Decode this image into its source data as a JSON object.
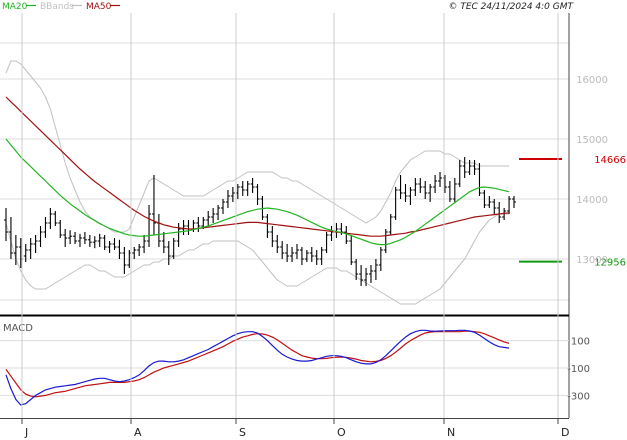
{
  "header": {
    "legend": [
      {
        "label": "MA20",
        "color": "#22b422"
      },
      {
        "label": "BBands",
        "color": "#c0c0c0"
      },
      {
        "label": "MA50",
        "color": "#a01010"
      }
    ],
    "copyright": "© TEC 24/11/2024 4:0 GMT"
  },
  "chart_data": [
    {
      "type": "line",
      "title": "",
      "x_tick_labels": [
        "J",
        "A",
        "S",
        "O",
        "N",
        "D"
      ],
      "y_tick_labels": [
        "13000",
        "14000",
        "15000",
        "16000"
      ],
      "ylim": [
        12100,
        17100
      ],
      "series_colors": {
        "price": "#000000",
        "ma20": "#22b422",
        "ma50": "#a01010",
        "bbands": "#c0c0c0"
      },
      "levels": [
        {
          "label": "14666",
          "value": 14666,
          "color": "#cc0000"
        },
        {
          "label": "12956",
          "value": 12956,
          "color": "#119911"
        }
      ],
      "candles": [
        [
          13650,
          13850,
          13300,
          13450
        ],
        [
          13450,
          13700,
          13000,
          13100
        ],
        [
          13100,
          13400,
          12900,
          13200
        ],
        [
          13200,
          13350,
          12850,
          13000
        ],
        [
          13050,
          13250,
          12950,
          13150
        ],
        [
          13150,
          13350,
          13000,
          13250
        ],
        [
          13250,
          13400,
          13100,
          13300
        ],
        [
          13300,
          13550,
          13200,
          13450
        ],
        [
          13450,
          13700,
          13350,
          13600
        ],
        [
          13600,
          13850,
          13500,
          13750
        ],
        [
          13750,
          13800,
          13550,
          13600
        ],
        [
          13600,
          13650,
          13350,
          13400
        ],
        [
          13400,
          13500,
          13200,
          13350
        ],
        [
          13350,
          13480,
          13250,
          13380
        ],
        [
          13380,
          13450,
          13250,
          13300
        ],
        [
          13300,
          13420,
          13200,
          13350
        ],
        [
          13350,
          13450,
          13250,
          13320
        ],
        [
          13320,
          13400,
          13200,
          13280
        ],
        [
          13280,
          13380,
          13180,
          13300
        ],
        [
          13300,
          13420,
          13200,
          13350
        ],
        [
          13350,
          13400,
          13150,
          13200
        ],
        [
          13200,
          13300,
          13100,
          13250
        ],
        [
          13250,
          13350,
          13150,
          13200
        ],
        [
          13200,
          13320,
          13000,
          13100
        ],
        [
          13100,
          13200,
          12750,
          12900
        ],
        [
          12900,
          13150,
          12850,
          13100
        ],
        [
          13100,
          13200,
          13000,
          13150
        ],
        [
          13150,
          13250,
          13050,
          13200
        ],
        [
          13200,
          13400,
          13100,
          13300
        ],
        [
          13300,
          13900,
          13200,
          13750
        ],
        [
          13750,
          14400,
          13400,
          13600
        ],
        [
          13600,
          13750,
          13200,
          13300
        ],
        [
          13300,
          13450,
          13100,
          13200
        ],
        [
          13200,
          13300,
          12900,
          13050
        ],
        [
          13050,
          13350,
          13000,
          13300
        ],
        [
          13300,
          13600,
          13200,
          13500
        ],
        [
          13500,
          13650,
          13400,
          13550
        ],
        [
          13550,
          13650,
          13400,
          13500
        ],
        [
          13500,
          13650,
          13450,
          13600
        ],
        [
          13600,
          13700,
          13450,
          13550
        ],
        [
          13550,
          13700,
          13500,
          13650
        ],
        [
          13650,
          13800,
          13550,
          13700
        ],
        [
          13700,
          13850,
          13600,
          13750
        ],
        [
          13750,
          13900,
          13650,
          13850
        ],
        [
          13850,
          14000,
          13750,
          13950
        ],
        [
          13950,
          14150,
          13850,
          14050
        ],
        [
          14050,
          14200,
          13950,
          14100
        ],
        [
          14100,
          14250,
          14000,
          14200
        ],
        [
          14200,
          14300,
          14050,
          14150
        ],
        [
          14150,
          14300,
          14050,
          14250
        ],
        [
          14250,
          14350,
          14100,
          14200
        ],
        [
          14200,
          14250,
          13900,
          14000
        ],
        [
          14000,
          14050,
          13650,
          13700
        ],
        [
          13700,
          13750,
          13350,
          13450
        ],
        [
          13450,
          13550,
          13200,
          13300
        ],
        [
          13300,
          13400,
          13100,
          13200
        ],
        [
          13200,
          13300,
          13000,
          13100
        ],
        [
          13100,
          13250,
          12950,
          13050
        ],
        [
          13050,
          13200,
          12950,
          13100
        ],
        [
          13100,
          13250,
          13000,
          13150
        ],
        [
          13150,
          13200,
          12900,
          13000
        ],
        [
          13000,
          13150,
          12950,
          13100
        ],
        [
          13100,
          13200,
          12950,
          13050
        ],
        [
          13050,
          13150,
          12900,
          13000
        ],
        [
          13000,
          13200,
          12900,
          13150
        ],
        [
          13150,
          13450,
          13100,
          13400
        ],
        [
          13400,
          13550,
          13300,
          13450
        ],
        [
          13450,
          13600,
          13350,
          13500
        ],
        [
          13500,
          13600,
          13400,
          13450
        ],
        [
          13450,
          13550,
          13250,
          13300
        ],
        [
          13300,
          13400,
          12900,
          12950
        ],
        [
          12950,
          13000,
          12650,
          12750
        ],
        [
          12750,
          12900,
          12550,
          12650
        ],
        [
          12650,
          12850,
          12550,
          12750
        ],
        [
          12750,
          12900,
          12600,
          12800
        ],
        [
          12800,
          13000,
          12650,
          12900
        ],
        [
          12900,
          13200,
          12800,
          13150
        ],
        [
          13150,
          13500,
          13100,
          13450
        ],
        [
          13450,
          13750,
          13400,
          13700
        ],
        [
          13700,
          14200,
          13650,
          14150
        ],
        [
          14150,
          14400,
          14000,
          14100
        ],
        [
          14100,
          14250,
          13950,
          14050
        ],
        [
          14050,
          14200,
          13900,
          14150
        ],
        [
          14150,
          14350,
          14050,
          14250
        ],
        [
          14250,
          14350,
          14100,
          14200
        ],
        [
          14200,
          14300,
          14000,
          14100
        ],
        [
          14100,
          14250,
          13950,
          14200
        ],
        [
          14200,
          14400,
          14100,
          14300
        ],
        [
          14300,
          14450,
          14200,
          14350
        ],
        [
          14350,
          14400,
          14100,
          14200
        ],
        [
          14200,
          14300,
          13950,
          14000
        ],
        [
          14000,
          14350,
          13950,
          14250
        ],
        [
          14250,
          14650,
          14200,
          14550
        ],
        [
          14550,
          14700,
          14350,
          14450
        ],
        [
          14450,
          14650,
          14400,
          14550
        ],
        [
          14550,
          14650,
          14400,
          14500
        ],
        [
          14500,
          14600,
          14050,
          14100
        ],
        [
          14100,
          14150,
          13850,
          13900
        ],
        [
          13900,
          14050,
          13850,
          13950
        ],
        [
          13950,
          14000,
          13750,
          13850
        ],
        [
          13850,
          13950,
          13600,
          13700
        ],
        [
          13700,
          13850,
          13650,
          13800
        ],
        [
          13800,
          14050,
          13750,
          14000
        ],
        [
          14000,
          14050,
          13850,
          13950
        ]
      ],
      "ma20": [
        15000,
        14900,
        14800,
        14700,
        14620,
        14540,
        14460,
        14380,
        14300,
        14220,
        14140,
        14060,
        13990,
        13920,
        13860,
        13800,
        13740,
        13690,
        13640,
        13590,
        13550,
        13510,
        13480,
        13450,
        13420,
        13400,
        13390,
        13380,
        13380,
        13390,
        13400,
        13410,
        13420,
        13430,
        13440,
        13450,
        13460,
        13470,
        13490,
        13510,
        13530,
        13550,
        13580,
        13610,
        13640,
        13670,
        13700,
        13730,
        13760,
        13790,
        13810,
        13830,
        13840,
        13850,
        13840,
        13830,
        13810,
        13790,
        13760,
        13730,
        13690,
        13650,
        13610,
        13570,
        13530,
        13500,
        13480,
        13460,
        13440,
        13420,
        13390,
        13360,
        13330,
        13300,
        13270,
        13250,
        13240,
        13240,
        13260,
        13290,
        13320,
        13360,
        13410,
        13460,
        13520,
        13580,
        13640,
        13700,
        13760,
        13820,
        13880,
        13940,
        14000,
        14060,
        14120,
        14160,
        14190,
        14200,
        14190,
        14180,
        14160,
        14140,
        14120
      ],
      "ma50": [
        15700,
        15620,
        15540,
        15460,
        15380,
        15300,
        15220,
        15140,
        15060,
        14980,
        14900,
        14820,
        14740,
        14660,
        14580,
        14500,
        14430,
        14360,
        14290,
        14230,
        14170,
        14110,
        14050,
        13990,
        13930,
        13870,
        13810,
        13760,
        13710,
        13670,
        13630,
        13600,
        13570,
        13550,
        13530,
        13520,
        13510,
        13500,
        13500,
        13510,
        13520,
        13530,
        13540,
        13550,
        13560,
        13570,
        13580,
        13590,
        13600,
        13610,
        13610,
        13610,
        13600,
        13590,
        13580,
        13570,
        13560,
        13550,
        13540,
        13530,
        13520,
        13510,
        13500,
        13490,
        13480,
        13470,
        13460,
        13450,
        13440,
        13430,
        13420,
        13410,
        13400,
        13390,
        13380,
        13380,
        13380,
        13390,
        13400,
        13410,
        13420,
        13430,
        13450,
        13460,
        13480,
        13500,
        13520,
        13540,
        13560,
        13580,
        13600,
        13620,
        13640,
        13660,
        13680,
        13700,
        13710,
        13720,
        13730,
        13740,
        13750,
        13760,
        13770
      ],
      "bb_upper": [
        16100,
        16300,
        16300,
        16250,
        16150,
        16050,
        15950,
        15850,
        15700,
        15500,
        15200,
        14900,
        14600,
        14350,
        14150,
        13950,
        13800,
        13700,
        13650,
        13600,
        13550,
        13500,
        13450,
        13450,
        13450,
        13500,
        13700,
        13900,
        14100,
        14300,
        14350,
        14300,
        14250,
        14200,
        14150,
        14100,
        14050,
        14050,
        14050,
        14050,
        14050,
        14100,
        14150,
        14200,
        14250,
        14300,
        14300,
        14350,
        14400,
        14450,
        14450,
        14450,
        14450,
        14450,
        14450,
        14400,
        14350,
        14350,
        14300,
        14300,
        14250,
        14200,
        14150,
        14100,
        14050,
        14000,
        13950,
        13900,
        13850,
        13800,
        13750,
        13700,
        13650,
        13600,
        13650,
        13700,
        13800,
        13950,
        14100,
        14300,
        14450,
        14550,
        14650,
        14700,
        14750,
        14800,
        14800,
        14800,
        14800,
        14750,
        14750,
        14700,
        14650,
        14600,
        14600,
        14600,
        14550,
        14550,
        14550,
        14550,
        14550,
        14550,
        14550
      ],
      "bb_lower": [
        13600,
        13300,
        13000,
        12800,
        12650,
        12550,
        12500,
        12500,
        12500,
        12550,
        12600,
        12650,
        12700,
        12750,
        12800,
        12850,
        12900,
        12900,
        12850,
        12800,
        12800,
        12750,
        12700,
        12700,
        12700,
        12750,
        12800,
        12850,
        12900,
        12900,
        12950,
        12950,
        13000,
        13000,
        13050,
        13050,
        13100,
        13150,
        13150,
        13200,
        13250,
        13250,
        13300,
        13300,
        13300,
        13300,
        13300,
        13300,
        13250,
        13200,
        13150,
        13050,
        12950,
        12850,
        12750,
        12650,
        12600,
        12550,
        12550,
        12550,
        12600,
        12650,
        12700,
        12750,
        12800,
        12850,
        12850,
        12850,
        12800,
        12800,
        12750,
        12700,
        12650,
        12600,
        12550,
        12500,
        12450,
        12400,
        12350,
        12300,
        12250,
        12250,
        12250,
        12250,
        12300,
        12350,
        12400,
        12450,
        12500,
        12600,
        12700,
        12800,
        12900,
        13000,
        13150,
        13300,
        13450,
        13550,
        13650,
        13700,
        13750,
        13750,
        13750
      ]
    },
    {
      "type": "line",
      "title": "MACD",
      "y_tick_labels": [
        "100",
        "-100",
        "-300"
      ],
      "ylim": [
        -450,
        250
      ],
      "series_colors": {
        "macd": "#1a1ad0",
        "signal": "#c01010"
      },
      "macd": [
        -150,
        -250,
        -330,
        -370,
        -360,
        -330,
        -300,
        -280,
        -260,
        -250,
        -240,
        -235,
        -230,
        -225,
        -220,
        -210,
        -200,
        -190,
        -180,
        -175,
        -175,
        -185,
        -195,
        -200,
        -195,
        -185,
        -170,
        -150,
        -120,
        -85,
        -60,
        -50,
        -50,
        -55,
        -55,
        -50,
        -40,
        -25,
        -10,
        5,
        20,
        35,
        55,
        75,
        95,
        115,
        135,
        150,
        160,
        165,
        165,
        155,
        130,
        100,
        65,
        30,
        0,
        -20,
        -35,
        -45,
        -50,
        -50,
        -45,
        -35,
        -25,
        -15,
        -10,
        -10,
        -15,
        -25,
        -40,
        -55,
        -65,
        -70,
        -70,
        -60,
        -40,
        -10,
        25,
        60,
        95,
        125,
        150,
        165,
        175,
        175,
        170,
        168,
        170,
        172,
        172,
        172,
        175,
        175,
        170,
        160,
        140,
        115,
        90,
        70,
        55,
        50,
        45
      ],
      "signal": [
        -110,
        -160,
        -210,
        -260,
        -290,
        -305,
        -310,
        -305,
        -300,
        -290,
        -280,
        -275,
        -270,
        -260,
        -250,
        -240,
        -230,
        -225,
        -220,
        -215,
        -210,
        -205,
        -205,
        -205,
        -205,
        -200,
        -195,
        -185,
        -170,
        -150,
        -130,
        -115,
        -100,
        -90,
        -80,
        -70,
        -60,
        -50,
        -35,
        -20,
        -5,
        10,
        25,
        40,
        55,
        75,
        95,
        110,
        125,
        135,
        145,
        150,
        148,
        140,
        125,
        105,
        80,
        55,
        30,
        10,
        -10,
        -20,
        -28,
        -32,
        -32,
        -30,
        -25,
        -22,
        -20,
        -22,
        -28,
        -35,
        -45,
        -50,
        -55,
        -52,
        -45,
        -30,
        -10,
        15,
        45,
        75,
        100,
        120,
        140,
        155,
        162,
        165,
        165,
        165,
        165,
        165,
        165,
        168,
        168,
        165,
        160,
        150,
        135,
        120,
        105,
        90,
        80
      ]
    }
  ]
}
